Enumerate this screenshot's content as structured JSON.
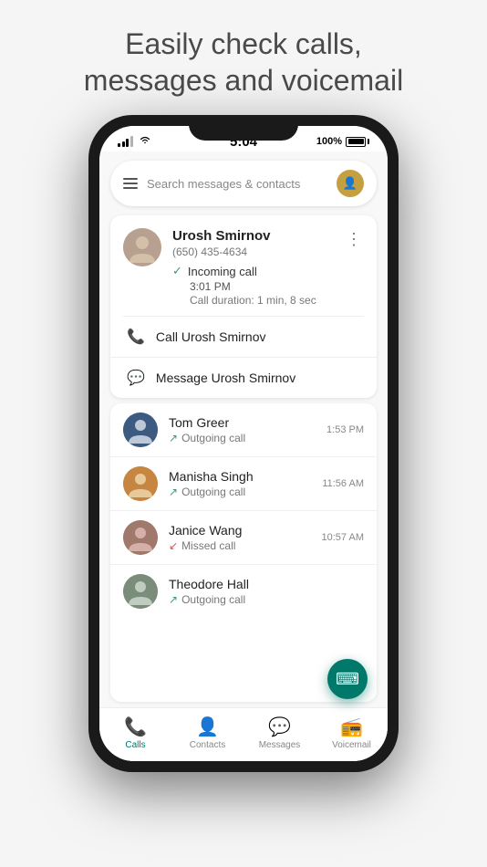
{
  "headline": {
    "line1": "Easily check calls,",
    "line2": "messages and voicemail"
  },
  "status_bar": {
    "time": "5:04",
    "battery": "100%"
  },
  "search": {
    "placeholder": "Search messages & contacts"
  },
  "expanded_contact": {
    "name": "Urosh Smirnov",
    "number": "(650) 435-4634",
    "call_type": "Incoming call",
    "call_time": "3:01 PM",
    "call_duration": "Call duration: 1 min, 8 sec",
    "action_call": "Call Urosh Smirnov",
    "action_message": "Message Urosh Smirnov"
  },
  "calls": [
    {
      "name": "Tom Greer",
      "type": "Outgoing call",
      "time": "1:53 PM",
      "status": "outgoing",
      "avatar_color": "#3d5a80"
    },
    {
      "name": "Manisha Singh",
      "type": "Outgoing call",
      "time": "11:56 AM",
      "status": "outgoing",
      "avatar_color": "#c68642"
    },
    {
      "name": "Janice Wang",
      "type": "Missed call",
      "time": "10:57 AM",
      "status": "missed",
      "avatar_color": "#a0796c"
    },
    {
      "name": "Theodore Hall",
      "type": "Outgoing call",
      "time": "",
      "status": "outgoing",
      "avatar_color": "#7a8c7a"
    }
  ],
  "nav": {
    "calls_label": "Calls",
    "contacts_label": "Contacts",
    "messages_label": "Messages",
    "voicemail_label": "Voicemail"
  }
}
